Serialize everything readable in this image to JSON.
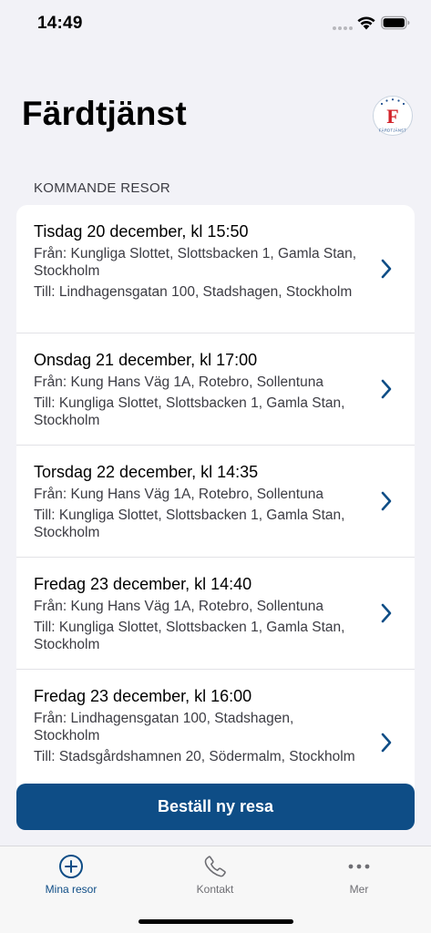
{
  "status_bar": {
    "time": "14:49"
  },
  "header": {
    "title": "Färdtjänst",
    "logo_letter": "F",
    "logo_text": "FÄRDTJÄNST"
  },
  "section_title": "KOMMANDE RESOR",
  "trips": [
    {
      "date": "Tisdag 20 december, kl 15:50",
      "from": "Från: Kungliga Slottet, Slottsbacken 1, Gamla Stan, Stockholm",
      "to": "Till: Lindhagensgatan 100, Stadshagen, Stockholm"
    },
    {
      "date": "Onsdag 21 december, kl 17:00",
      "from": "Från: Kung Hans Väg 1A, Rotebro, Sollentuna",
      "to": "Till: Kungliga Slottet, Slottsbacken 1, Gamla Stan, Stockholm"
    },
    {
      "date": "Torsdag 22 december, kl 14:35",
      "from": "Från: Kung Hans Väg 1A, Rotebro, Sollentuna",
      "to": "Till: Kungliga Slottet, Slottsbacken 1, Gamla Stan, Stockholm"
    },
    {
      "date": "Fredag 23 december, kl 14:40",
      "from": "Från: Kung Hans Väg 1A, Rotebro, Sollentuna",
      "to": "Till: Kungliga Slottet, Slottsbacken 1, Gamla Stan, Stockholm"
    },
    {
      "date": "Fredag 23 december, kl 16:00",
      "from": "Från: Lindhagensgatan 100, Stadshagen, Stockholm",
      "to": "Till: Stadsgårdshamnen 20, Södermalm, Stockholm"
    }
  ],
  "cta": {
    "label": "Beställ ny resa"
  },
  "tabs": [
    {
      "label": "Mina resor",
      "icon": "plus-circle-icon"
    },
    {
      "label": "Kontakt",
      "icon": "phone-icon"
    },
    {
      "label": "Mer",
      "icon": "more-dots-icon"
    }
  ],
  "colors": {
    "accent": "#0e4d86",
    "background": "#f2f2f7",
    "logo_red": "#d2232a"
  }
}
